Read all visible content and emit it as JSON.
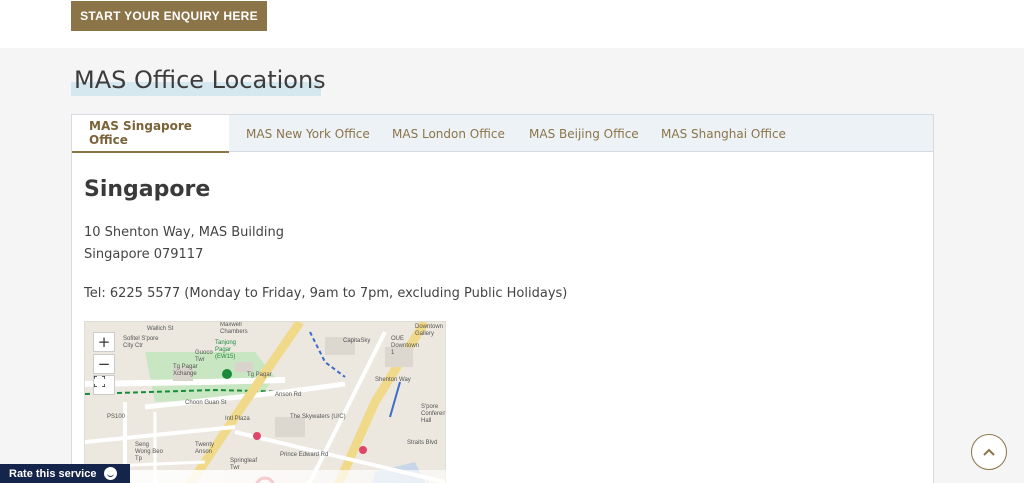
{
  "header": {
    "enquiry_label": "START YOUR ENQUIRY HERE"
  },
  "section": {
    "title": "MAS Office Locations"
  },
  "tabs": [
    {
      "label": "MAS Singapore Office",
      "active": true
    },
    {
      "label": "MAS New York Office",
      "active": false
    },
    {
      "label": "MAS London Office",
      "active": false
    },
    {
      "label": "MAS Beijing Office",
      "active": false
    },
    {
      "label": "MAS Shanghai Office",
      "active": false
    }
  ],
  "office": {
    "heading": "Singapore",
    "address_line1": "10 Shenton Way, MAS Building",
    "address_line2": "Singapore 079117",
    "tel": "Tel: 6225 5577 (Monday to Friday, 9am to 7pm, excluding Public Holidays)"
  },
  "map": {
    "zoom_in": "+",
    "zoom_out": "−",
    "labels": {
      "wallich": "Wallich St",
      "maxwell": "Maxwell Chambers",
      "sofitel": "Sofitel S'pore City Ctr",
      "tanjong": "Tanjong Pagar (EW15)",
      "guoco": "Guoco Twr",
      "tgpagar_xchange": "Tg Pagar Xchange",
      "tgpagar_plaza": "Tg Pagar",
      "choon": "Choon Guan St",
      "capitasky": "CapitaSky",
      "oue": "OUE Downtown 1",
      "downtown": "Downtown Gallery",
      "intl": "Intl Plaza",
      "skywaters": "The Skywaters (U/C)",
      "twenty": "Twenty Anson",
      "springleaf": "Springleaf Twr",
      "seng": "Seng Wong Beo Tp",
      "ps100": "PS100",
      "spore_conf": "S'pore Conference Hall",
      "anson": "Anson Rd",
      "shenton": "Shenton Way",
      "prince": "Prince Edward Rd",
      "straits": "Straits Blvd"
    }
  },
  "feedback": {
    "label": "Rate this service"
  }
}
